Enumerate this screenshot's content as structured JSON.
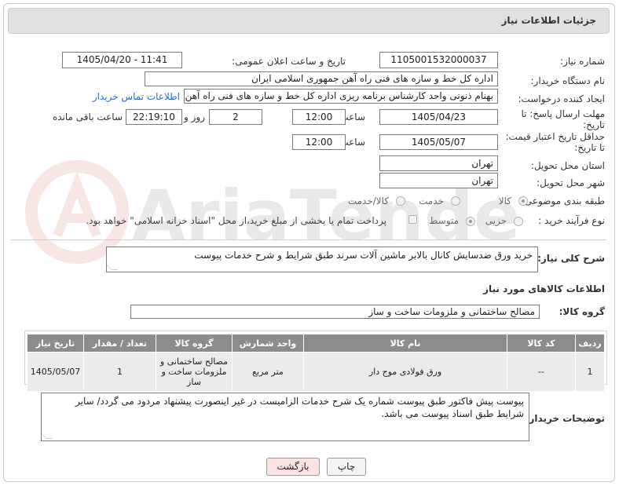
{
  "header": {
    "title": "جزئیات اطلاعات نیاز"
  },
  "form": {
    "need_number": {
      "label": "شماره نیاز:",
      "value": "1105001532000037"
    },
    "announce": {
      "label": "تاریخ و ساعت اعلان عمومی:",
      "value": "1405/04/20 - 11:41"
    },
    "buyer_org": {
      "label": "نام دستگاه خریدار:",
      "value": "اداره کل خط و سازه های فنی راه آهن جمهوری اسلامی ایران"
    },
    "creator": {
      "label": "ایجاد کننده درخواست:",
      "value": "بهنام ذنونی واحد کارشناس برنامه ریزی اداره کل خط و سازه های فنی راه آهن ج",
      "contact_link": "اطلاعات تماس خریدار"
    },
    "reply_deadline": {
      "label_line1": "مهلت ارسال پاسخ: تا",
      "label_line2": "تاریخ:",
      "date": "1405/04/23",
      "time_label": "ساعت",
      "time": "12:00",
      "days": "2",
      "days_label": "روز و",
      "remaining_time": "22:19:10",
      "remaining_label": "ساعت باقی مانده"
    },
    "price_validity": {
      "label_line1": "حداقل تاریخ اعتبار قیمت:",
      "label_line2": "تا تاریخ:",
      "date": "1405/05/07",
      "time_label": "ساعت",
      "time": "12:00"
    },
    "province": {
      "label": "استان محل تحویل:",
      "value": "تهران"
    },
    "city": {
      "label": "شهر محل تحویل:",
      "value": "تهران"
    },
    "category": {
      "label": "طبقه بندی موضوعی:",
      "options": [
        "کالا",
        "خدمت",
        "کالا/خدمت"
      ],
      "selected": "کالا"
    },
    "purchase_type": {
      "label": "نوع فرآیند خرید :",
      "options": [
        "جزیی",
        "متوسط"
      ],
      "selected": "متوسط",
      "payment_note": "پرداخت تمام یا بخشی از مبلغ خرید،از محل \"اسناد خزانه اسلامی\" خواهد بود."
    }
  },
  "summary": {
    "label": "شرح کلی نیاز:",
    "value": "خرید ورق ضدسایش کانال بالابر ماشین آلات سرند طبق شرایط و شرح خدمات پیوست"
  },
  "goods_section": {
    "title": "اطلاعات کالاهای مورد نیاز",
    "group_label": "گروه کالا:",
    "group_value": "مصالح ساختمانی و ملزومات ساخت و ساز"
  },
  "table": {
    "headers": [
      "ردیف",
      "کد کالا",
      "نام کالا",
      "واحد شمارش",
      "گروه کالا",
      "تعداد / مقدار",
      "تاریخ نیاز"
    ],
    "rows": [
      [
        "1",
        "--",
        "ورق فولادی موج دار",
        "متر مربع",
        "مصالح ساختمانی و ملزومات ساخت و ساز",
        "1",
        "1405/05/07"
      ]
    ]
  },
  "buyer_notes": {
    "label": "توضیحات خریدار:",
    "value": "پیوست پیش فاکتور طبق پیوست شماره یک شرح خدمات الزامیست در غیر اینصورت پیشنهاد مردود می گردد/ سایر شرایط طبق اسناد پیوست می باشد."
  },
  "buttons": {
    "print": "چاپ",
    "back": "بازگشت"
  },
  "watermark": {
    "text": "AriaTender.net"
  },
  "colors": {
    "title_bg": "#e1e1e1",
    "table_header_bg": "#8c8c8c",
    "table_cell_bg": "#ebebeb",
    "link": "#2a6bd1",
    "back_button_bg": "#fbe3e3"
  }
}
